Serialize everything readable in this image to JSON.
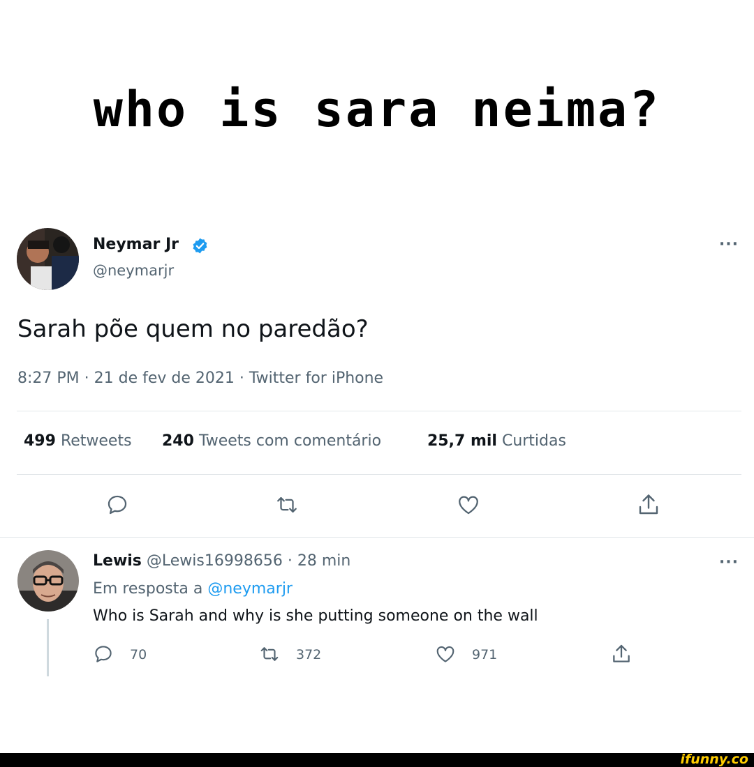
{
  "meme_title": "who is sara neima?",
  "tweet": {
    "author_name": "Neymar Jr",
    "author_handle": "@neymarjr",
    "text": "Sarah põe quem no paredão?",
    "meta": "8:27 PM · 21 de fev de 2021 · Twitter for iPhone",
    "more": "···",
    "stats": {
      "retweets_count": "499",
      "retweets_label": "Retweets",
      "quotes_count": "240",
      "quotes_label": "Tweets com comentário",
      "likes_count": "25,7 mil",
      "likes_label": "Curtidas"
    }
  },
  "reply": {
    "author_name": "Lewis",
    "handle_time": "@Lewis16998656 · 28 min",
    "context_prefix": "Em resposta a ",
    "context_mention": "@neymarjr",
    "text": "Who is Sarah and why is she putting someone on the wall",
    "more": "···",
    "reply_count": "70",
    "retweet_count": "372",
    "like_count": "971"
  },
  "watermark": "ifunny.co",
  "colors": {
    "verified": "#1d9bf0",
    "icon": "#536471",
    "mention": "#1d9bf0",
    "watermark": "#ffcc00"
  },
  "icons": [
    "verified-badge-icon",
    "reply-icon",
    "retweet-icon",
    "like-icon",
    "share-icon",
    "more-icon"
  ]
}
